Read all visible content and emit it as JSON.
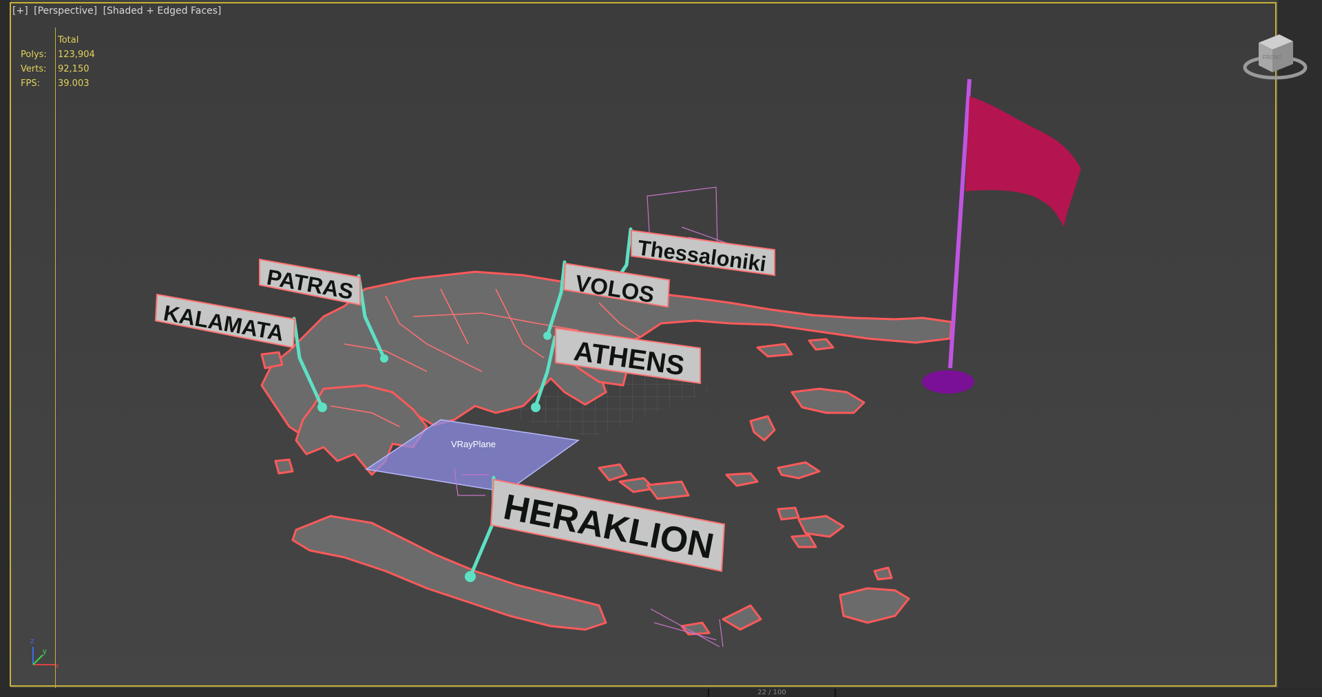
{
  "viewport": {
    "labels": [
      "[+]",
      "[Perspective]",
      "[Shaded + Edged Faces]"
    ]
  },
  "stats": {
    "header": "Total",
    "polys_label": "Polys:",
    "polys_value": "123,904",
    "verts_label": "Verts:",
    "verts_value": "92,150",
    "fps_label": "FPS:",
    "fps_value": "39.003"
  },
  "cities": {
    "thessaloniki": "Thessaloniki",
    "volos": "VOLOS",
    "patras": "PATRAS",
    "kalamata": "KALAMATA",
    "athens": "ATHENS",
    "heraklion": "HERAKLION"
  },
  "vray_plane_label": "VRayPlane",
  "axis_gizmo": {
    "x": "x",
    "y": "y",
    "z": "z"
  },
  "bottom_readout": "22 / 100",
  "colors": {
    "frame": "#c9b23a",
    "land_fill": "#6d6d6d",
    "land_edge": "#ff5a5a",
    "pin": "#5de0c4",
    "flag_cloth": "#b4144f",
    "flag_pole": "#c055e0",
    "flag_base": "#7a1095",
    "vray_plane": "#8c8ce6"
  }
}
